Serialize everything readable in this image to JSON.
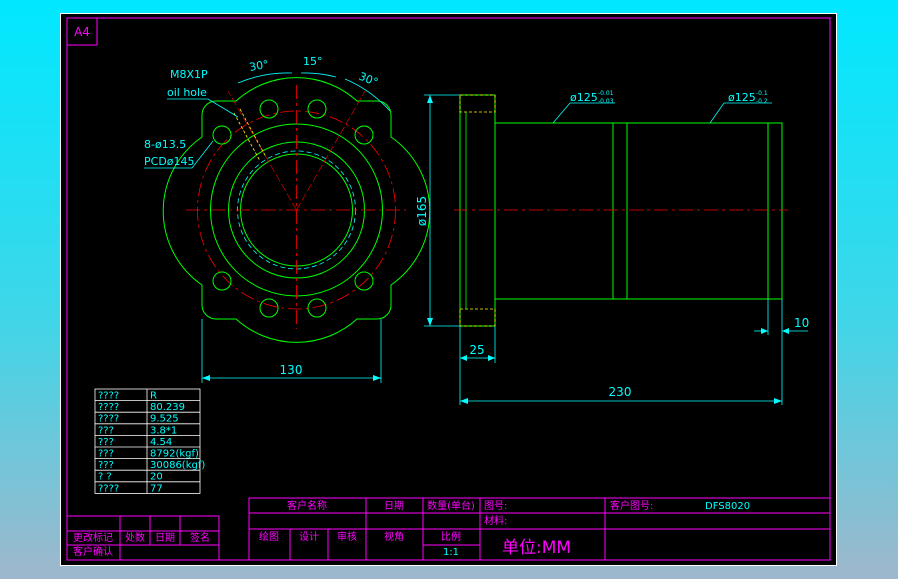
{
  "sheet": {
    "size": "A4"
  },
  "front_view": {
    "oil_hole_label": "M8X1P",
    "oil_hole_label2": "oil hole",
    "angle_left": "30°",
    "angle_mid": "15°",
    "angle_right": "30°",
    "holes_label": "8-ø13.5",
    "pcd_label": "PCDø145",
    "width_dim": "130"
  },
  "side_view": {
    "dia1_label": "ø125",
    "dia1_tol_upper": "-0.01",
    "dia1_tol_lower": "-0.03",
    "dia2_label": "ø125",
    "dia2_tol_upper": "-0.1",
    "dia2_tol_lower": "-0.2",
    "flange_dia": "ø165",
    "flange_width": "25",
    "total_length": "230",
    "end_length": "10"
  },
  "spec_table": [
    [
      "????",
      "R"
    ],
    [
      "????",
      "80.239"
    ],
    [
      "????",
      "9.525"
    ],
    [
      "???",
      "3.8*1"
    ],
    [
      "???",
      "4.54"
    ],
    [
      "???",
      "8792(kgf)"
    ],
    [
      "???",
      "30086(kgf)"
    ],
    [
      "?  ?",
      "20"
    ],
    [
      "????",
      "77"
    ]
  ],
  "title_block": {
    "customer_name": "客户名称",
    "date": "日期",
    "quantity": "数量(单台)",
    "part_no": "图号:",
    "drawing_no_label": "客户图号:",
    "drawing_no": "DFS8020",
    "material": "材料:",
    "draw": "绘图",
    "design": "设计",
    "review": "审核",
    "view_angle": "视角",
    "scale_label": "比例",
    "scale": "1:1",
    "unit": "单位:MM",
    "change_mark": "更改标记",
    "place": "处数",
    "date2": "日期",
    "sign": "签名",
    "customer_confirm": "客户确认"
  },
  "colors": {
    "border": "#ff00ff",
    "outline": "#00ff00",
    "center": "#ff0000",
    "dimension": "#00ffff",
    "text_dim": "#00ffff",
    "hidden": "#ffff00",
    "table_text": "#00ffff",
    "title_text": "#ff00ff"
  }
}
